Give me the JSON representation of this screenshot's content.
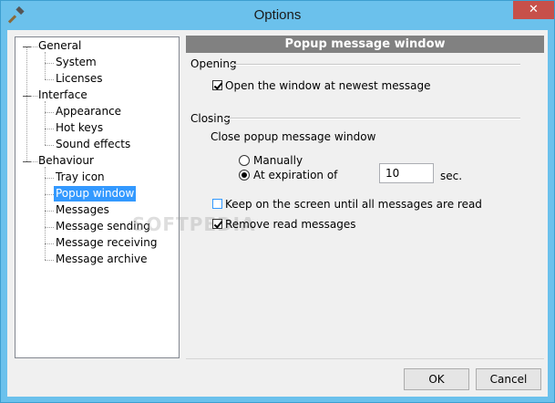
{
  "window": {
    "title": "Options",
    "close_glyph": "✕"
  },
  "icons": {
    "app": "hammer-icon",
    "close": "close-icon"
  },
  "tree": {
    "general": {
      "label": "General",
      "children": [
        "System",
        "Licenses"
      ]
    },
    "interface": {
      "label": "Interface",
      "children": [
        "Appearance",
        "Hot keys",
        "Sound effects"
      ]
    },
    "behaviour": {
      "label": "Behaviour",
      "children": [
        "Tray icon",
        "Popup window",
        "Messages",
        "Message sending",
        "Message receiving",
        "Message archive"
      ]
    },
    "selected": "Popup window"
  },
  "panel": {
    "title": "Popup message window",
    "opening": {
      "label": "Opening",
      "open_newest": {
        "label": "Open the window at newest message",
        "checked": true
      }
    },
    "closing": {
      "label": "Closing",
      "subtitle": "Close popup message window",
      "manually": {
        "label": "Manually",
        "selected": false
      },
      "expiration": {
        "label": "At expiration of",
        "selected": true,
        "value": "10",
        "unit": "sec."
      },
      "keep_on_screen": {
        "label": "Keep on the screen until all messages are read",
        "checked": false
      },
      "remove_read": {
        "label": "Remove read messages",
        "checked": true
      }
    }
  },
  "buttons": {
    "ok": "OK",
    "cancel": "Cancel"
  },
  "watermark": "SOFTPEDIA",
  "colors": {
    "title_bar": "#6bc1ec",
    "selection": "#3399ff",
    "header": "#818181",
    "close": "#c7504a"
  }
}
